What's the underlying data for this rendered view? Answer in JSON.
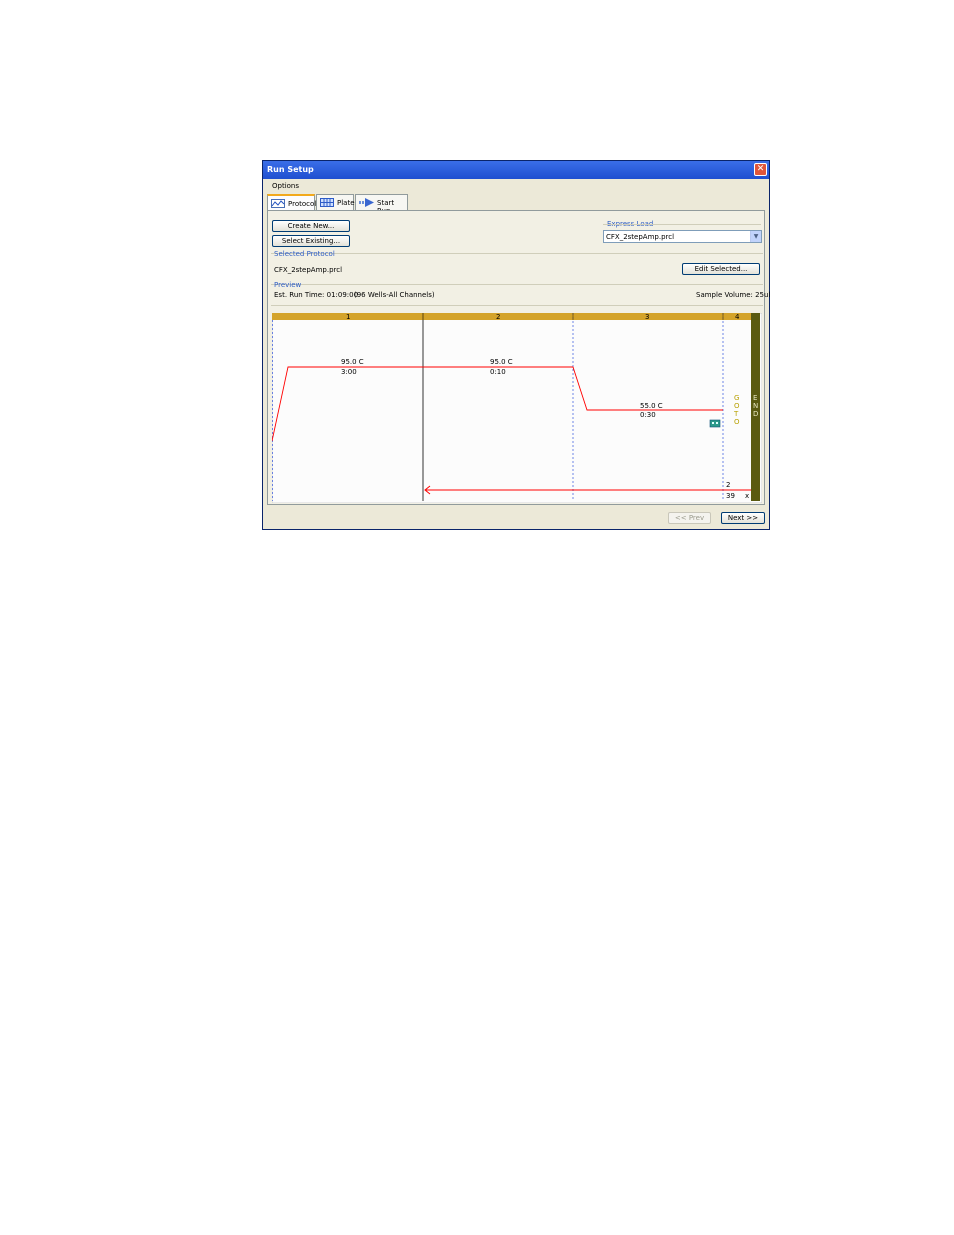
{
  "window": {
    "title": "Run Setup",
    "close_glyph": "✕"
  },
  "menu": {
    "options_label": "Options"
  },
  "tabs": [
    {
      "label": "Protocol",
      "icon": "protocol-graph-icon"
    },
    {
      "label": "Plate",
      "icon": "plate-grid-icon"
    },
    {
      "label": "Start Run",
      "icon": "start-run-arrow-icon"
    }
  ],
  "buttons": {
    "create_new": "Create New...",
    "select_existing": "Select Existing...",
    "edit_selected": "Edit Selected...",
    "prev": "<< Prev",
    "next": "Next >>"
  },
  "express_load": {
    "label": "Express Load",
    "value": "CFX_2stepAmp.prcl"
  },
  "selected_protocol": {
    "label": "Selected Protocol",
    "value": "CFX_2stepAmp.prcl"
  },
  "preview": {
    "label": "Preview",
    "run_time": "Est. Run Time:  01:09:00",
    "wells": "(96 Wells-All Channels)",
    "sample_volume": "Sample Volume:  25ul"
  },
  "protocol": {
    "steps": [
      {
        "number": "1",
        "temp": "95.0   C",
        "time": "3:00"
      },
      {
        "number": "2",
        "temp": "95.0   C",
        "time": "0:10"
      },
      {
        "number": "3",
        "temp": "55.0   C",
        "time": "0:30"
      },
      {
        "number": "4"
      }
    ],
    "goto_letters": [
      "G",
      "O",
      "T",
      "O"
    ],
    "goto_step": "2",
    "repeat_count": "39",
    "repeat_suffix": "x",
    "end_letters": [
      "E",
      "N",
      "D"
    ],
    "colors": {
      "header": "#d4a32a",
      "end_bar": "#5a5a10",
      "line": "#ff0000",
      "goto": "#b8a000"
    }
  }
}
